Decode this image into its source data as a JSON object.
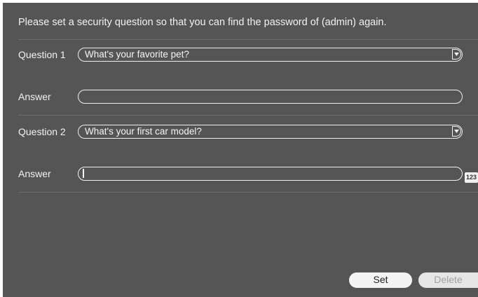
{
  "intro": "Please set a security question so that you can find the password of (admin) again.",
  "question1": {
    "label": "Question 1",
    "selected": "What's your favorite pet?",
    "answer_label": "Answer",
    "answer_value": ""
  },
  "question2": {
    "label": "Question 2",
    "selected": "What's your first car model?",
    "answer_label": "Answer",
    "answer_value": ""
  },
  "keyboard_badge": "123",
  "icons": {
    "dropdown": "chevron-down-icon"
  },
  "buttons": {
    "set": "Set",
    "delete": "Delete"
  },
  "colors": {
    "panel_bg": "#555555",
    "text": "#f2f2f2",
    "disabled_text": "#a2a2a2"
  }
}
